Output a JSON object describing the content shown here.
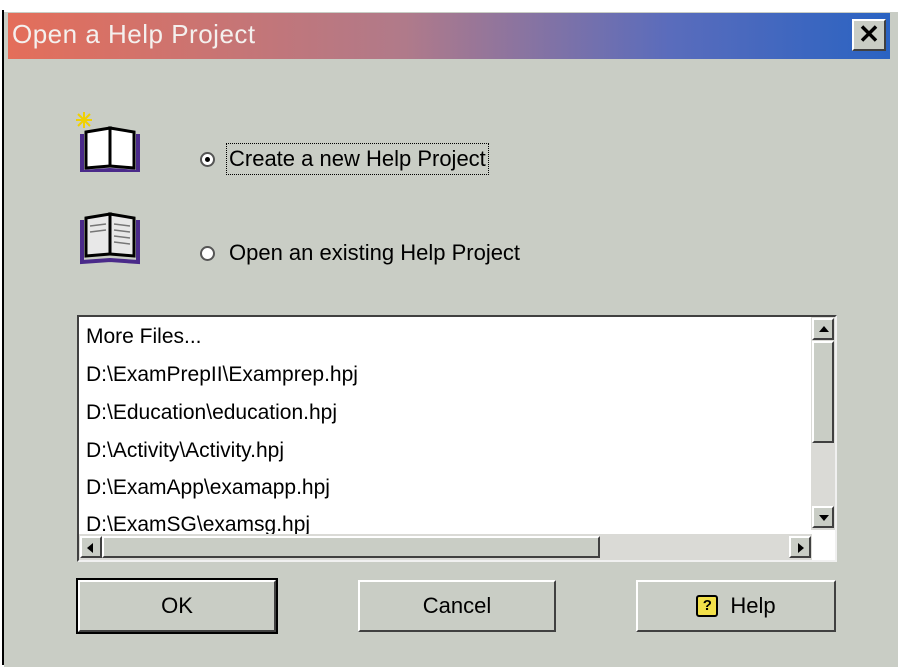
{
  "window": {
    "title": "Open a Help Project",
    "close_label": "✕"
  },
  "options": {
    "create": {
      "label": "Create a new Help Project",
      "selected": true
    },
    "open": {
      "label": "Open an existing Help Project",
      "selected": false
    }
  },
  "file_list": {
    "items": [
      "More Files...",
      "D:\\ExamPrepII\\Examprep.hpj",
      "D:\\Education\\education.hpj",
      "D:\\Activity\\Activity.hpj",
      "D:\\ExamApp\\examapp.hpj",
      "D:\\ExamSG\\examsg.hpj"
    ]
  },
  "buttons": {
    "ok": "OK",
    "cancel": "Cancel",
    "help": "Help",
    "help_icon_glyph": "?"
  },
  "colors": {
    "dialog_bg": "#c9cdc5",
    "title_start": "#e46e5a",
    "title_end": "#2a63c2"
  }
}
